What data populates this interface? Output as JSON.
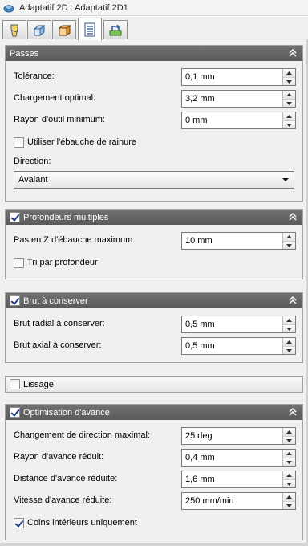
{
  "window": {
    "title": "Adaptatif 2D : Adaptatif 2D1"
  },
  "tabs": [
    {
      "icon": "tool-icon"
    },
    {
      "icon": "geometry-icon"
    },
    {
      "icon": "heights-icon"
    },
    {
      "icon": "passes-icon"
    },
    {
      "icon": "linking-icon"
    }
  ],
  "passes": {
    "title": "Passes",
    "tolerance_label": "Tolérance:",
    "tolerance_value": "0,1 mm",
    "optimal_load_label": "Chargement optimal:",
    "optimal_load_value": "3,2 mm",
    "min_tool_radius_label": "Rayon d'outil minimum:",
    "min_tool_radius_value": "0 mm",
    "slot_clearing_label": "Utiliser l'ébauche de rainure",
    "direction_label": "Direction:",
    "direction_value": "Avalant"
  },
  "multiple_depths": {
    "title": "Profondeurs multiples",
    "max_stepdown_label": "Pas en Z d'ébauche maximum:",
    "max_stepdown_value": "10 mm",
    "order_by_depth_label": "Tri par profondeur"
  },
  "stock_to_leave": {
    "title": "Brut à conserver",
    "radial_label": "Brut radial à conserver:",
    "radial_value": "0,5 mm",
    "axial_label": "Brut axial à conserver:",
    "axial_value": "0,5 mm"
  },
  "smoothing": {
    "title": "Lissage"
  },
  "feed_optimization": {
    "title": "Optimisation d'avance",
    "max_direction_change_label": "Changement de direction maximal:",
    "max_direction_change_value": "25 deg",
    "reduced_feed_radius_label": "Rayon d'avance réduit:",
    "reduced_feed_radius_value": "0,4 mm",
    "reduced_feed_distance_label": "Distance d'avance réduite:",
    "reduced_feed_distance_value": "1,6 mm",
    "reduced_feedrate_label": "Vitesse d'avance réduite:",
    "reduced_feedrate_value": "250 mm/min",
    "inner_corners_label": "Coins intérieurs uniquement"
  },
  "colors": {
    "header_dark": "#636363",
    "panel_bg": "#f0f0f0",
    "checkmark": "#1c3f8a"
  }
}
